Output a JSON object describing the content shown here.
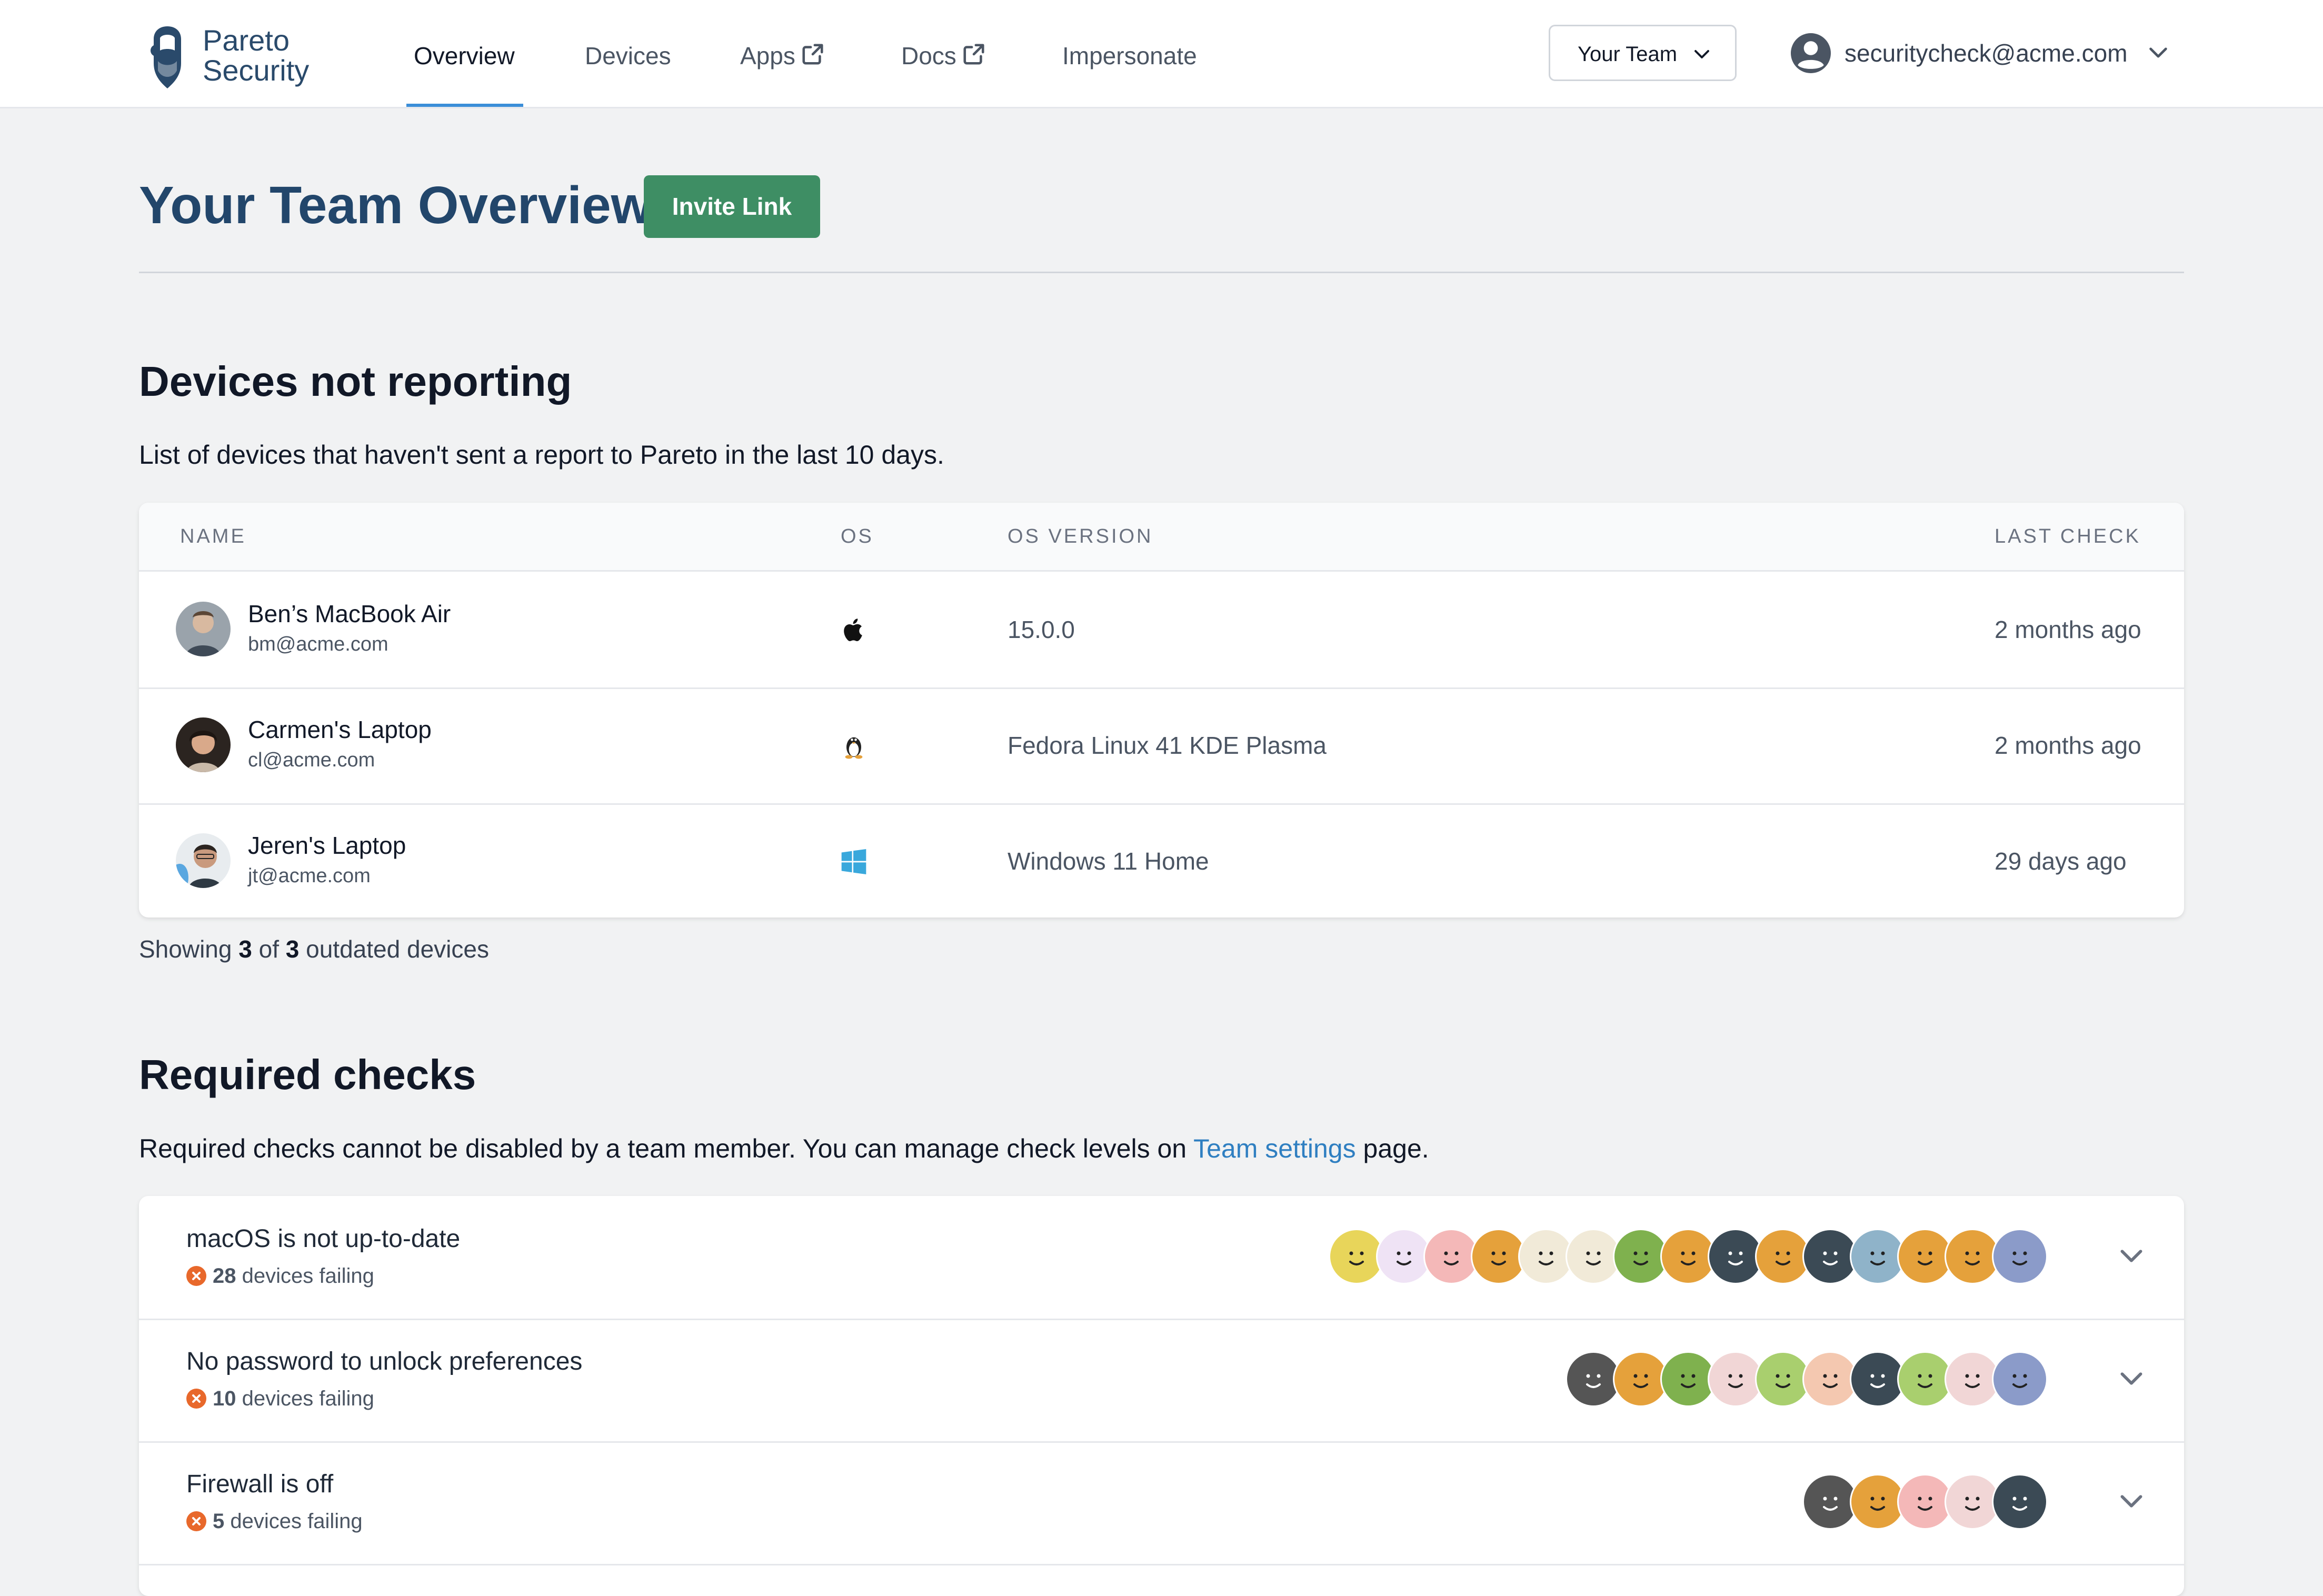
{
  "nav": {
    "brand_line1": "Pareto",
    "brand_line2": "Security",
    "links": [
      {
        "label": "Overview"
      },
      {
        "label": "Devices"
      },
      {
        "label": "Apps"
      },
      {
        "label": "Docs"
      },
      {
        "label": "Impersonate"
      }
    ],
    "team_selector": "Your Team",
    "user_email": "securitycheck@acme.com"
  },
  "header": {
    "title": "Your Team Overview",
    "invite_button": "Invite Link"
  },
  "not_reporting": {
    "heading": "Devices not reporting",
    "description": "List of devices that haven't sent a report to Pareto in the last 10 days.",
    "columns": [
      "Name",
      "OS",
      "OS Version",
      "Last Check"
    ],
    "rows": [
      {
        "name": "Ben’s MacBook Air",
        "email": "bm@acme.com",
        "os": "apple-icon",
        "os_version": "15.0.0",
        "last_check": "2 months ago"
      },
      {
        "name": "Carmen's Laptop",
        "email": "cl@acme.com",
        "os": "linux-icon",
        "os_version": "Fedora Linux 41 KDE Plasma",
        "last_check": "2 months ago"
      },
      {
        "name": "Jeren's Laptop",
        "email": "jt@acme.com",
        "os": "windows-icon",
        "os_version": "Windows 11 Home",
        "last_check": "29 days ago"
      }
    ],
    "showing_prefix": "Showing",
    "showing_count": "3",
    "showing_of": "of",
    "showing_total": "3",
    "showing_suffix": "outdated devices"
  },
  "required_checks": {
    "heading": "Required checks",
    "description_before": "Required checks cannot be disabled by a team member. You can manage check levels on",
    "link": "Team settings",
    "description_after": "page.",
    "items": [
      {
        "title": "macOS is not up-to-date",
        "count": "28",
        "suffix": "devices failing",
        "avatar_colors": [
          "#e8d55a",
          "#efe3f5",
          "#f4b8b8",
          "#e5a13b",
          "#f1ead8",
          "#f1ead8",
          "#7fb14e",
          "#e5a13b",
          "#3b4a55",
          "#e5a13b",
          "#3b4a55",
          "#8fb3c9",
          "#e5a13b",
          "#e5a13b",
          "#8b9bc9"
        ]
      },
      {
        "title": "No password to unlock preferences",
        "count": "10",
        "suffix": "devices failing",
        "avatar_colors": [
          "#555555",
          "#e5a13b",
          "#7fb14e",
          "#f1d6d6",
          "#a9cf6e",
          "#f4c8b0",
          "#3b4a55",
          "#a9cf6e",
          "#f1d6d6",
          "#8b9bc9"
        ]
      },
      {
        "title": "Firewall is off",
        "count": "5",
        "suffix": "devices failing",
        "avatar_colors": [
          "#555555",
          "#e5a13b",
          "#f4b8b8",
          "#f1d6d6",
          "#3b4a55"
        ]
      }
    ]
  }
}
